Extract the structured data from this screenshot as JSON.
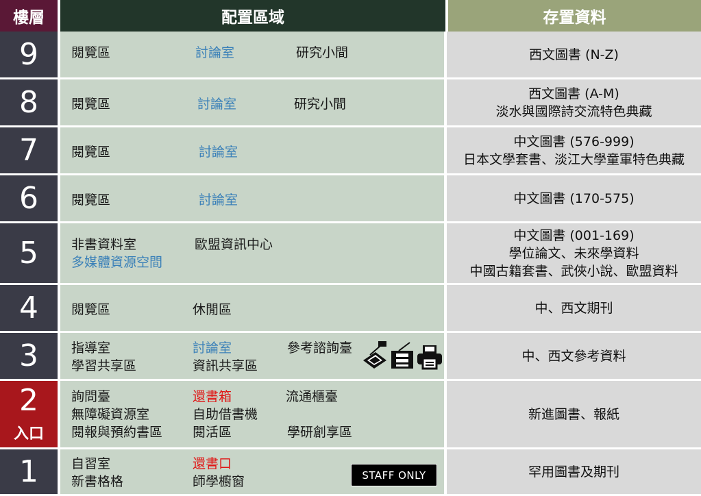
{
  "header": {
    "floor": "樓層",
    "area": "配置區域",
    "collection": "存置資料"
  },
  "floors": [
    {
      "number": "9",
      "areas": [
        {
          "text": "閱覽區",
          "color": "normal"
        },
        {
          "text": "討論室",
          "color": "blue"
        },
        {
          "text": "研究小間",
          "color": "normal"
        }
      ],
      "collection": [
        "西文圖書 (N-Z)"
      ]
    },
    {
      "number": "8",
      "areas": [
        {
          "text": "閱覽區",
          "color": "normal"
        },
        {
          "text": "討論室",
          "color": "blue"
        },
        {
          "text": "研究小間",
          "color": "normal"
        }
      ],
      "collection": [
        "西文圖書 (A-M)",
        "淡水與國際詩交流特色典藏"
      ]
    },
    {
      "number": "7",
      "areas": [
        {
          "text": "閱覽區",
          "color": "normal"
        },
        {
          "text": "討論室",
          "color": "blue"
        }
      ],
      "collection": [
        "中文圖書 (576-999)",
        "日本文學套書、淡江大學童軍特色典藏"
      ]
    },
    {
      "number": "6",
      "areas": [
        {
          "text": "閱覽區",
          "color": "normal"
        },
        {
          "text": "討論室",
          "color": "blue"
        }
      ],
      "collection": [
        "中文圖書 (170-575)"
      ]
    },
    {
      "number": "5",
      "areas": [
        {
          "text": "非書資料室",
          "color": "normal"
        },
        {
          "text": "歐盟資訊中心",
          "color": "normal"
        },
        {
          "text": "多媒體資源空間",
          "color": "blue"
        }
      ],
      "collection": [
        "中文圖書 (001-169)",
        "學位論文、未來學資料",
        "中國古籍套書、武俠小說、歐盟資料"
      ]
    },
    {
      "number": "4",
      "areas": [
        {
          "text": "閱覽區",
          "color": "normal"
        },
        {
          "text": "休閒區",
          "color": "normal"
        }
      ],
      "collection": [
        "中、西文期刊"
      ]
    },
    {
      "number": "3",
      "areas": [
        {
          "text": "指導室",
          "color": "normal"
        },
        {
          "text": "討論室",
          "color": "blue"
        },
        {
          "text": "參考諮詢臺",
          "color": "normal"
        },
        {
          "text": "學習共享區",
          "color": "normal"
        },
        {
          "text": "資訊共享區",
          "color": "normal"
        }
      ],
      "icons": [
        "scanner-icon",
        "copier-icon",
        "printer-icon"
      ],
      "collection": [
        "中、西文參考資料"
      ]
    },
    {
      "number": "2",
      "sublabel": "入口",
      "areas": [
        {
          "text": "詢問臺",
          "color": "normal"
        },
        {
          "text": "還書箱",
          "color": "red"
        },
        {
          "text": "流通櫃臺",
          "color": "normal"
        },
        {
          "text": "無障礙資源室",
          "color": "normal"
        },
        {
          "text": "自助借書機",
          "color": "normal"
        },
        {
          "text": "閱報與預約書區",
          "color": "normal"
        },
        {
          "text": "閱活區",
          "color": "normal"
        },
        {
          "text": "學研創享區",
          "color": "normal"
        }
      ],
      "collection": [
        "新進圖書、報紙"
      ]
    },
    {
      "number": "1",
      "areas": [
        {
          "text": "自習室",
          "color": "normal"
        },
        {
          "text": "還書口",
          "color": "red"
        },
        {
          "text": "新書格格",
          "color": "normal"
        },
        {
          "text": "師學櫥窗",
          "color": "normal"
        }
      ],
      "badge": "STAFF ONLY",
      "collection": [
        "罕用圖書及期刊"
      ]
    }
  ],
  "colors": {
    "floor_bg": "#3a3b47",
    "entrance_bg": "#a8171c",
    "header_floor_bg": "#5a1836",
    "header_area_bg": "#22362a",
    "header_collection_bg": "#9aa47a",
    "area_bg": "#c8d5c8",
    "collection_bg": "#d9d9d9",
    "link_blue": "#3a80b8",
    "alert_red": "#e01515"
  }
}
